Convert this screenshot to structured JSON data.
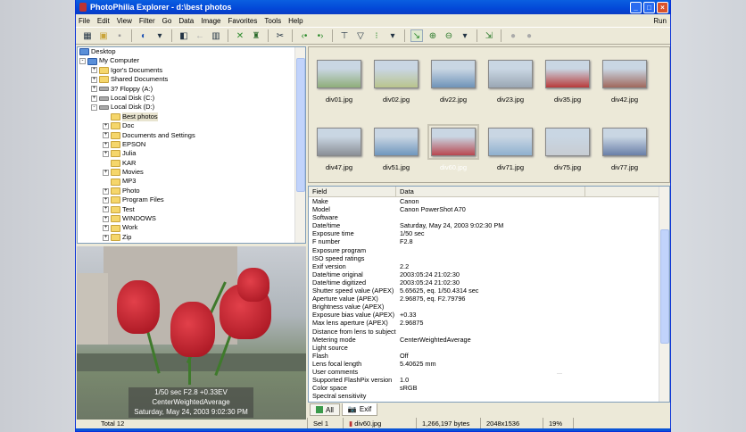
{
  "window": {
    "title": "PhotoPhilia Explorer - d:\\best photos"
  },
  "menu": [
    "File",
    "Edit",
    "View",
    "Filter",
    "Go",
    "Data",
    "Image",
    "Favorites",
    "Tools",
    "Help"
  ],
  "menu_run": "Run",
  "tree": [
    {
      "label": "Desktop",
      "level": 0,
      "exp": "",
      "icon": "desktop"
    },
    {
      "label": "My Computer",
      "level": 0,
      "exp": "-",
      "icon": "computer"
    },
    {
      "label": "Igor's Documents",
      "level": 1,
      "exp": "+",
      "icon": "folder"
    },
    {
      "label": "Shared Documents",
      "level": 1,
      "exp": "+",
      "icon": "folder"
    },
    {
      "label": "3? Floppy (A:)",
      "level": 1,
      "exp": "+",
      "icon": "floppy"
    },
    {
      "label": "Local Disk (C:)",
      "level": 1,
      "exp": "+",
      "icon": "disk"
    },
    {
      "label": "Local Disk (D:)",
      "level": 1,
      "exp": "-",
      "icon": "disk"
    },
    {
      "label": "Best photos",
      "level": 2,
      "exp": "",
      "icon": "folder",
      "selected": true
    },
    {
      "label": "Doc",
      "level": 2,
      "exp": "+",
      "icon": "folder"
    },
    {
      "label": "Documents and Settings",
      "level": 2,
      "exp": "+",
      "icon": "folder"
    },
    {
      "label": "EPSON",
      "level": 2,
      "exp": "+",
      "icon": "folder"
    },
    {
      "label": "Julia",
      "level": 2,
      "exp": "+",
      "icon": "folder"
    },
    {
      "label": "KAR",
      "level": 2,
      "exp": "",
      "icon": "folder"
    },
    {
      "label": "Movies",
      "level": 2,
      "exp": "+",
      "icon": "folder"
    },
    {
      "label": "MP3",
      "level": 2,
      "exp": "",
      "icon": "folder"
    },
    {
      "label": "Photo",
      "level": 2,
      "exp": "+",
      "icon": "folder"
    },
    {
      "label": "Program Files",
      "level": 2,
      "exp": "+",
      "icon": "folder"
    },
    {
      "label": "Test",
      "level": 2,
      "exp": "+",
      "icon": "folder"
    },
    {
      "label": "WINDOWS",
      "level": 2,
      "exp": "+",
      "icon": "folder"
    },
    {
      "label": "Work",
      "level": 2,
      "exp": "+",
      "icon": "folder"
    },
    {
      "label": "Zip",
      "level": 2,
      "exp": "+",
      "icon": "folder"
    }
  ],
  "preview": {
    "line1": "1/50 sec   F2.8   +0.33EV",
    "line2": "CenterWeightedAverage",
    "line3": "Saturday, May 24, 2003 9:02:30 PM"
  },
  "thumbnails": [
    {
      "name": "div01.jpg",
      "color": "#8fae7a"
    },
    {
      "name": "div02.jpg",
      "color": "#b9c48d"
    },
    {
      "name": "div22.jpg",
      "color": "#6f93b8"
    },
    {
      "name": "div23.jpg",
      "color": "#9aa7b4"
    },
    {
      "name": "div35.jpg",
      "color": "#b83a3a"
    },
    {
      "name": "div42.jpg",
      "color": "#a0685c"
    },
    {
      "name": "div47.jpg",
      "color": "#8a8f96"
    },
    {
      "name": "div51.jpg",
      "color": "#6f96bd"
    },
    {
      "name": "div60.jpg",
      "color": "#b8474f",
      "selected": true
    },
    {
      "name": "div71.jpg",
      "color": "#8fb0cf"
    },
    {
      "name": "div75.jpg",
      "color": "#c7ccd2"
    },
    {
      "name": "div77.jpg",
      "color": "#6a7fa8"
    }
  ],
  "grid": {
    "headers": [
      "Field",
      "Data"
    ],
    "rows": [
      [
        "Make",
        "Canon"
      ],
      [
        "Model",
        "Canon PowerShot A70"
      ],
      [
        "Software",
        ""
      ],
      [
        "Date/time",
        "Saturday, May 24, 2003 9:02:30 PM"
      ],
      [
        "Exposure time",
        "1/50 sec"
      ],
      [
        "F number",
        "F2.8"
      ],
      [
        "Exposure program",
        ""
      ],
      [
        "ISO speed ratings",
        ""
      ],
      [
        "Exif version",
        "2.2"
      ],
      [
        "Date/time original",
        "2003:05:24 21:02:30"
      ],
      [
        "Date/time digitized",
        "2003:05:24 21:02:30"
      ],
      [
        "Shutter speed value (APEX)",
        "5.65625, eq. 1/50.4314 sec"
      ],
      [
        "Aperture value (APEX)",
        "2.96875, eq. F2.79796"
      ],
      [
        "Brightness value (APEX)",
        ""
      ],
      [
        "Exposure bias value (APEX)",
        "+0.33"
      ],
      [
        "Max lens aperture (APEX)",
        "2.96875"
      ],
      [
        "Distance from lens to subject",
        ""
      ],
      [
        "Metering mode",
        "CenterWeightedAverage"
      ],
      [
        "Light source",
        ""
      ],
      [
        "Flash",
        "Off"
      ],
      [
        "Lens focal length",
        "5.40625 mm"
      ],
      [
        "User comments",
        "..."
      ],
      [
        "Supported FlashPix version",
        "1.0"
      ],
      [
        "Color space",
        "sRGB"
      ],
      [
        "Spectral sensitivity",
        ""
      ]
    ]
  },
  "tabs": [
    "All",
    "Exif"
  ],
  "status": {
    "total": "Total 12",
    "sel": "Sel 1",
    "file": "div60.jpg",
    "size": "1,266,197 bytes",
    "dims": "2048x1536",
    "zoom": "19%"
  }
}
